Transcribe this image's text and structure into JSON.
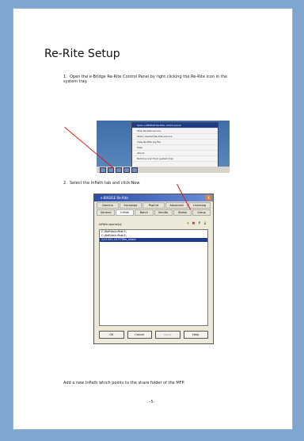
{
  "title": "Re-Rite Setup",
  "steps": [
    {
      "num": "1.",
      "text": "Open the e-Bridge Re-Rite Control Panel by right clicking the Re-Rite icon in the system tray."
    },
    {
      "num": "2.",
      "text": "Select the InPath tab and click New"
    }
  ],
  "context_menu": {
    "items": [
      {
        "label": "Open e-BRIDGE Re-Rite control panel",
        "highlight": true
      },
      {
        "label": "Stop Re-Rite service",
        "highlight": false
      },
      {
        "label": "Start | Restart Re-Rite service",
        "highlight": false
      },
      {
        "label": "View Re-Rite log file",
        "highlight": false
      },
      {
        "label": "Help",
        "highlight": false
      },
      {
        "label": "About",
        "highlight": false
      },
      {
        "label": "Remove icon from system tray",
        "highlight": false
      }
    ]
  },
  "dialog": {
    "title": "e-BRIDGE Re-Rite",
    "close": "X",
    "tabs_row1": [
      "Domino",
      "Exchange",
      "PopOut",
      "Advanced",
      "Licensing"
    ],
    "tabs_row2": [
      "General",
      "InPath",
      "Batch",
      "Sendto",
      "Global",
      "Group"
    ],
    "inpath_label": "InPath source(s):",
    "icons": [
      "✦",
      "✖",
      "↑",
      "↓"
    ],
    "list": [
      {
        "text": "C:\\ReRite\\InPath1\\",
        "selected": false
      },
      {
        "text": "C:\\ReRite\\InPath2\\",
        "selected": false
      },
      {
        "text": "\\\\10.101.10.57\\file_share",
        "selected": true
      }
    ],
    "buttons": [
      "OK",
      "Cancel",
      "Apply",
      "Help"
    ]
  },
  "footnote": "Add a new InPath which points to the share folder of the MFP.",
  "page_number": "-5-"
}
